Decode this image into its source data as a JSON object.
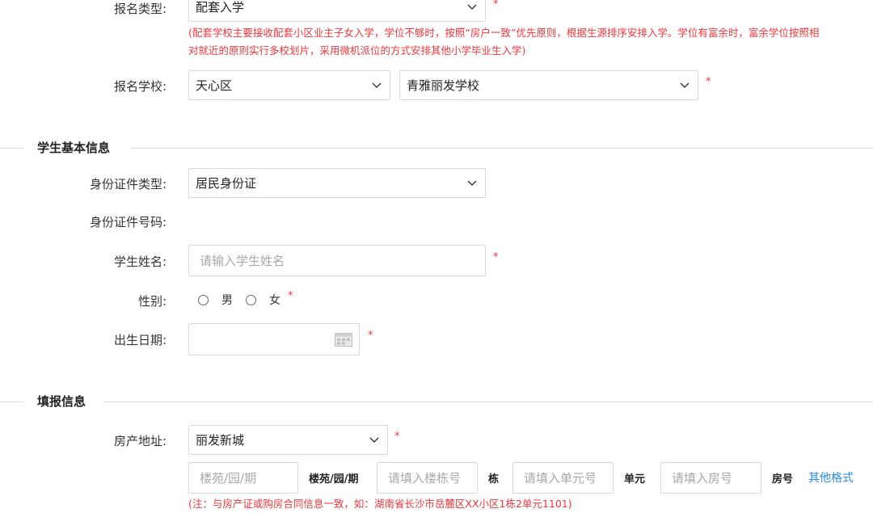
{
  "enroll": {
    "type_label": "报名类型:",
    "type_value": "配套入学",
    "type_note": "(配套学校主要接收配套小区业主子女入学，学位不够时，按照“房户一致”优先原则，根据生源排序安排入学。学位有富余时，富余学位按照相对就近的原则实行多校划片，采用微机派位的方式安排其他小学毕业生入学)",
    "school_label": "报名学校:",
    "district_value": "天心区",
    "school_value": "青雅丽发学校"
  },
  "student": {
    "section_title": "学生基本信息",
    "id_type_label": "身份证件类型:",
    "id_type_value": "居民身份证",
    "id_number_label": "身份证件号码:",
    "name_label": "学生姓名:",
    "name_placeholder": "请输入学生姓名",
    "gender_label": "性别:",
    "gender_options": [
      "男",
      "女"
    ],
    "birth_label": "出生日期:"
  },
  "fill": {
    "section_title": "填报信息",
    "address_label": "房产地址:",
    "address_value": "丽发新城",
    "estate_placeholder": "楼苑/园/期",
    "estate_unit": "楼苑/园/期",
    "building_placeholder": "请填入楼栋号",
    "building_unit": "栋",
    "unit_placeholder": "请填入单元号",
    "unit_unit": "单元",
    "room_placeholder": "请填入房号",
    "room_unit": "房号",
    "other_format": "其他格式",
    "address_note": "(注：与房产证或购房合同信息一致，如：湖南省长沙市岳麓区XX小区1栋2单元1101)"
  },
  "required_mark": "*",
  "colors": {
    "required": "#e8383d",
    "link": "#2a8bd8",
    "border": "#d8d8d8"
  }
}
